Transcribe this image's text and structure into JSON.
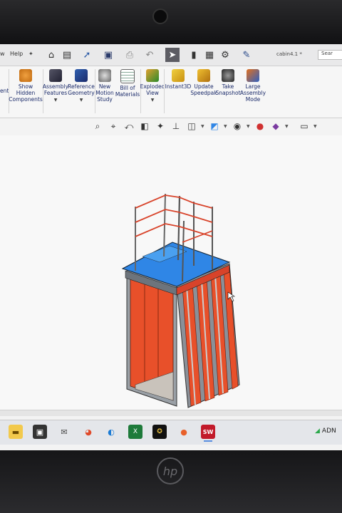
{
  "menu": {
    "item1": "w",
    "item2": "Help",
    "pin": "✦"
  },
  "document_title": "cabin4.1 *",
  "search_label": "Sear",
  "quick_access": [
    {
      "name": "home-icon",
      "glyph": "⌂"
    },
    {
      "name": "new-document-icon",
      "glyph": "▤"
    },
    {
      "name": "open-icon",
      "glyph": "➚"
    },
    {
      "name": "save-icon",
      "glyph": "▣"
    },
    {
      "name": "print-icon",
      "glyph": "⎙"
    },
    {
      "name": "undo-icon",
      "glyph": "↶"
    },
    {
      "name": "select-arrow-icon",
      "glyph": "➤"
    },
    {
      "name": "rebuild-icon",
      "glyph": "▮"
    },
    {
      "name": "file-properties-icon",
      "glyph": "▦"
    },
    {
      "name": "options-gear-icon",
      "glyph": "⚙"
    },
    {
      "name": "customize-icon",
      "glyph": "✎"
    }
  ],
  "ribbon": {
    "partial_left": "ent",
    "show_hidden": "Show\nHidden\nComponents",
    "assembly_features": "Assembly\nFeatures",
    "reference_geometry": "Reference\nGeometry",
    "new_motion_study": "New\nMotion\nStudy",
    "bill_of_materials": "Bill of\nMaterials",
    "exploded_view": "Exploded\nView",
    "instant3d": "Instant3D",
    "update_speedpak": "Update\nSpeedpak",
    "take_snapshot": "Take\nSnapshot",
    "large_assembly_mode": "Large\nAssembly\nMode"
  },
  "colors": {
    "cabin_red": "#e8502a",
    "roof_blue": "#2f86e6",
    "frame_gray": "#8a9098",
    "ribbon_text": "#1a2a6a"
  },
  "taskbar": {
    "tray_text": "ADN",
    "apps": [
      "file-explorer-icon",
      "store-icon",
      "mail-icon",
      "office-icon",
      "edge-icon",
      "excel-icon",
      "game-icon",
      "firefox-icon",
      "solidworks-icon"
    ]
  },
  "laptop_logo": "hp"
}
